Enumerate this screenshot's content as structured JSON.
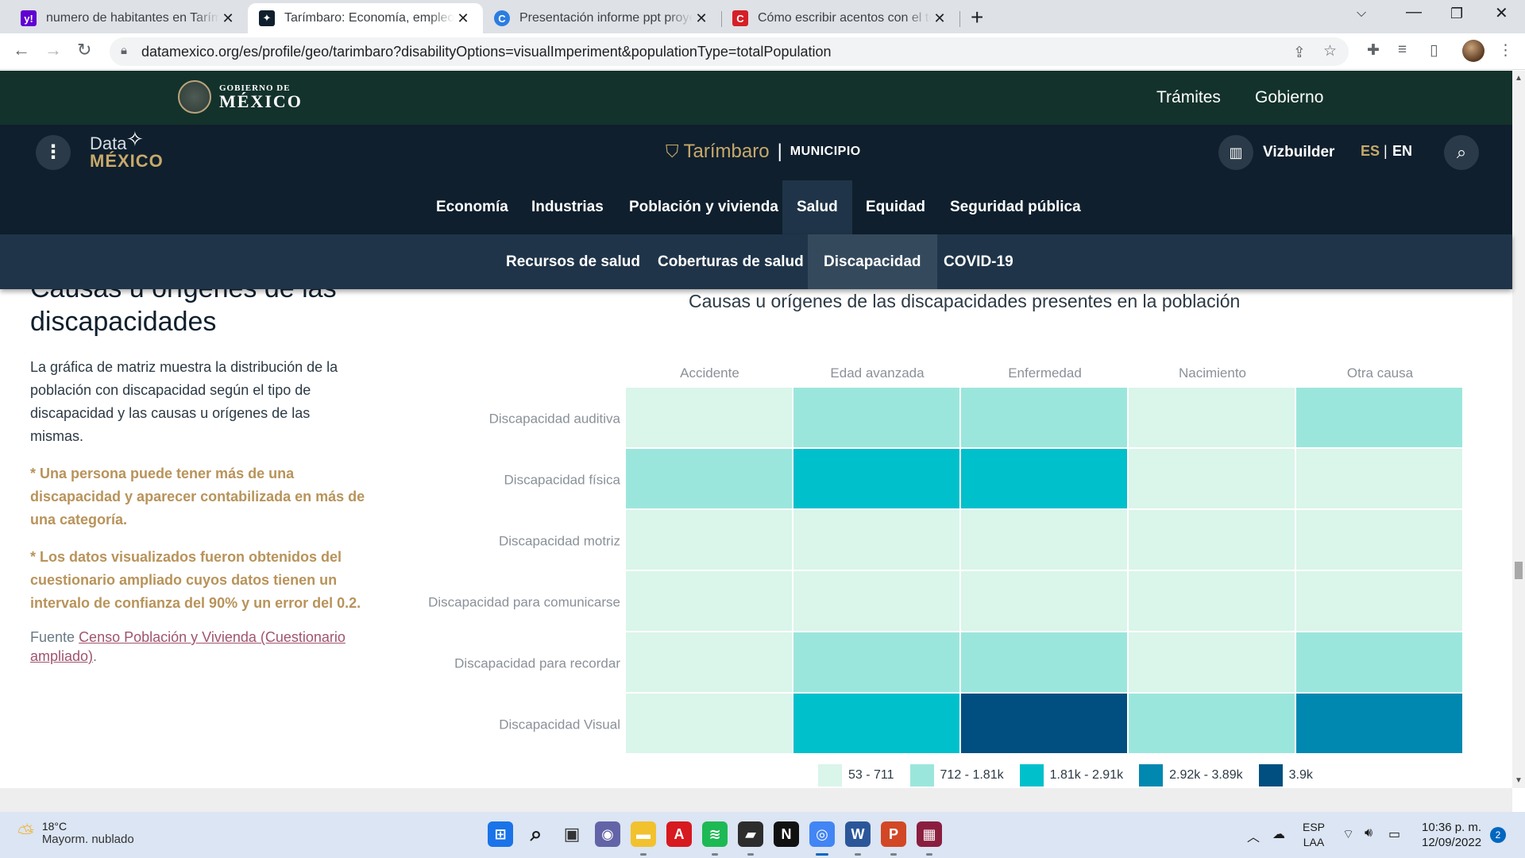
{
  "browser": {
    "tabs": [
      {
        "title": "numero de habitantes en Tarímbaro",
        "favicon_color": "#6001d2",
        "favicon_glyph": "y!"
      },
      {
        "title": "Tarímbaro: Economía, empleo, equidad",
        "favicon_color": "#0f1f2d",
        "favicon_glyph": "✦"
      },
      {
        "title": "Presentación informe ppt proyecto",
        "favicon_color": "#2a7de1",
        "favicon_glyph": "C"
      },
      {
        "title": "Cómo escribir acentos con el teclado",
        "favicon_color": "#d61f26",
        "favicon_glyph": "C"
      }
    ],
    "new_tab_icon": "plus-icon",
    "url": "datamexico.org/es/profile/geo/tarimbaro?disabilityOptions=visualImperiment&populationType=totalPopulation"
  },
  "gov_header": {
    "logo_small": "GOBIERNO DE",
    "logo_big": "MÉXICO",
    "links": [
      "Trámites",
      "Gobierno"
    ]
  },
  "site_header": {
    "logo_line1": "Data",
    "logo_line2": "MÉXICO",
    "place_name": "Tarímbaro",
    "place_level": "MUNICIPIO",
    "vizbuilder_label": "Vizbuilder",
    "lang_es": "ES",
    "lang_sep": "|",
    "lang_en": "EN",
    "main_nav": [
      "Economía",
      "Industrias",
      "Población y vivienda",
      "Salud",
      "Equidad",
      "Seguridad pública"
    ],
    "main_nav_active": "Salud",
    "sub_nav": [
      "Recursos de salud",
      "Coberturas de salud",
      "Discapacidad",
      "COVID-19"
    ],
    "sub_nav_active": "Discapacidad"
  },
  "section": {
    "title_line1": "Causas u orígenes de las",
    "title_line2": "discapacidades",
    "description": "La gráfica de matriz muestra la distribución de la población con discapacidad según el tipo de discapacidad y las causas u orígenes de las mismas.",
    "note1": "* Una persona puede tener más de una discapacidad y aparecer contabilizada en más de una categoría.",
    "note2": "* Los datos visualizados fueron obtenidos del cuestionario ampliado cuyos datos tienen un intervalo de confianza del 90% y un error del 0.2.",
    "source_label": "Fuente",
    "source_link": "Censo Población y Vivienda (Cuestionario ampliado)",
    "source_end": "."
  },
  "chart_data": {
    "type": "heatmap",
    "title": "Causas u orígenes de las discapacidades presentes en la población",
    "columns": [
      "Accidente",
      "Edad avanzada",
      "Enfermedad",
      "Nacimiento",
      "Otra causa"
    ],
    "rows": [
      "Discapacidad auditiva",
      "Discapacidad física",
      "Discapacidad motriz",
      "Discapacidad para comunicarse",
      "Discapacidad para recordar",
      "Discapacidad Visual"
    ],
    "bins": [
      {
        "label": "53 - 711",
        "color": "#daf5ea"
      },
      {
        "label": "712 - 1.81k",
        "color": "#9be6dc"
      },
      {
        "label": "1.81k - 2.91k",
        "color": "#00c0cc"
      },
      {
        "label": "2.92k - 3.89k",
        "color": "#0088b0"
      },
      {
        "label": "3.9k",
        "color": "#004f80"
      }
    ],
    "cell_bins": [
      [
        0,
        1,
        1,
        0,
        1
      ],
      [
        1,
        2,
        2,
        0,
        0
      ],
      [
        0,
        0,
        0,
        0,
        0
      ],
      [
        0,
        0,
        0,
        0,
        0
      ],
      [
        0,
        1,
        1,
        0,
        1
      ],
      [
        0,
        2,
        4,
        1,
        3
      ]
    ],
    "legend_position": "bottom"
  },
  "taskbar": {
    "temp": "18°C",
    "weather": "Mayorm. nublado",
    "apps": [
      {
        "name": "start-icon",
        "color": "#1a73e8",
        "glyph": "⊞"
      },
      {
        "name": "search-icon",
        "color": "transparent",
        "glyph": "⌕"
      },
      {
        "name": "task-view-icon",
        "color": "#4a4a4a",
        "glyph": "▣"
      },
      {
        "name": "chat-icon",
        "color": "#6264a7",
        "glyph": "◉"
      },
      {
        "name": "file-explorer-icon",
        "color": "#f2c12e",
        "glyph": "▬"
      },
      {
        "name": "acrobat-icon",
        "color": "#d71920",
        "glyph": "A"
      },
      {
        "name": "spotify-icon",
        "color": "#1db954",
        "glyph": "≋"
      },
      {
        "name": "sticky-notes-icon",
        "color": "#2d2d2d",
        "glyph": "▰"
      },
      {
        "name": "netflix-icon",
        "color": "#111111",
        "glyph": "N"
      },
      {
        "name": "chrome-icon",
        "color": "#4285f4",
        "glyph": "◎"
      },
      {
        "name": "word-icon",
        "color": "#2b579a",
        "glyph": "W"
      },
      {
        "name": "powerpoint-icon",
        "color": "#d24726",
        "glyph": "P"
      },
      {
        "name": "winrar-icon",
        "color": "#8b1e3f",
        "glyph": "▦"
      }
    ],
    "lang_line1": "ESP",
    "lang_line2": "LAA",
    "time": "10:36 p. m.",
    "date": "12/09/2022",
    "notifications": "2"
  }
}
